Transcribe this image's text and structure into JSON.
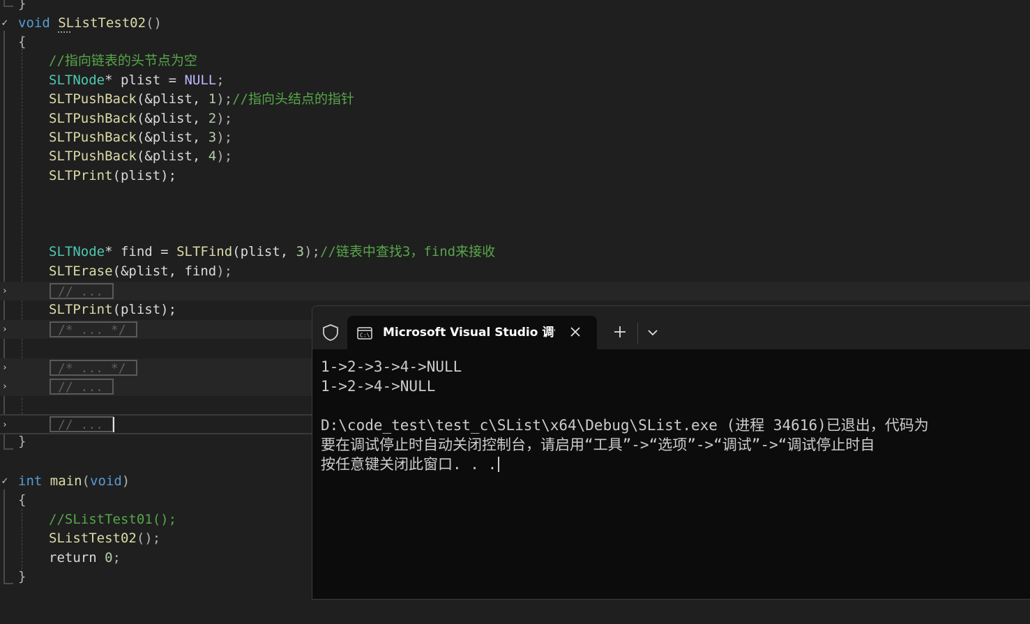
{
  "editor": {
    "lines": {
      "top_brace": "}",
      "fn2_kw": "void",
      "fn2_name": "SListTest02",
      "fn2_parens": "()",
      "fn2_open": "{",
      "c1": "//指向链表的头节点为空",
      "l1_type": "SLTNode",
      "l1_rest": "* plist = ",
      "l1_null": "NULL",
      "l1_end": ";",
      "push_fn": "SLTPushBack",
      "push1_args": "(&plist, ",
      "push1_num": "1",
      "push1_end": ");",
      "push1_comment": "//指向头结点的指针",
      "push2_args": "(&plist, ",
      "push2_num": "2",
      "push2_end": ");",
      "push3_args": "(&plist, ",
      "push3_num": "3",
      "push3_end": ");",
      "push4_args": "(&plist, ",
      "push4_num": "4",
      "push4_end": ");",
      "print_fn": "SLTPrint",
      "print_args": "(plist);",
      "find_type": "SLTNode",
      "find_star": "* ",
      "find_var": "find",
      "find_eq": " = ",
      "find_fn": "SLTFind",
      "find_args": "(plist, ",
      "find_num": "3",
      "find_end": ");",
      "find_comment": "//链表中查找3，find来接收",
      "erase_fn": "SLTErase",
      "erase_args_a": "(&plist, ",
      "erase_args_var": "find",
      "erase_args_b": ");",
      "fold1": "// ...",
      "print2_fn": "SLTPrint",
      "print2_args": "(plist);",
      "fold2": "/* ... */",
      "fold3": "/* ... */",
      "fold4": "// ...",
      "fold5": "// ...",
      "fn2_close": "}",
      "main_kw": "int",
      "main_name": "main",
      "main_paren_open": "(",
      "main_void": "void",
      "main_paren_close": ")",
      "main_open": "{",
      "main_c1": "//SListTest01();",
      "main_call": "SListTest02",
      "main_call_end": "();",
      "main_return_kw": "return",
      "main_return_num": "0",
      "main_return_end": ";",
      "main_close": "}"
    },
    "glyphs": {
      "expanded": "✓",
      "collapsed": "›"
    }
  },
  "terminal": {
    "tab_title": "Microsoft Visual Studio 调试控制台",
    "icons": {
      "shield": "shield-icon",
      "tab": "console-icon",
      "close": "close-icon",
      "new_tab": "plus-icon",
      "dropdown": "chevron-down-icon"
    },
    "output": [
      "1->2->3->4->NULL",
      "1->2->4->NULL",
      "",
      "D:\\code_test\\test_c\\SList\\x64\\Debug\\SList.exe (进程 34616)已退出，代码为",
      "要在调试停止时自动关闭控制台，请启用“工具”->“选项”->“调试”->“调试停止时自",
      "按任意键关闭此窗口. . ."
    ]
  },
  "colors": {
    "editor_bg": "#1f1f1f",
    "keyword": "#569cd6",
    "type": "#4ec9b0",
    "function": "#dcdcaa",
    "comment": "#57a64a",
    "number": "#b5cea8",
    "macro": "#beb7ff",
    "terminal_bg": "#0c0c0c"
  }
}
